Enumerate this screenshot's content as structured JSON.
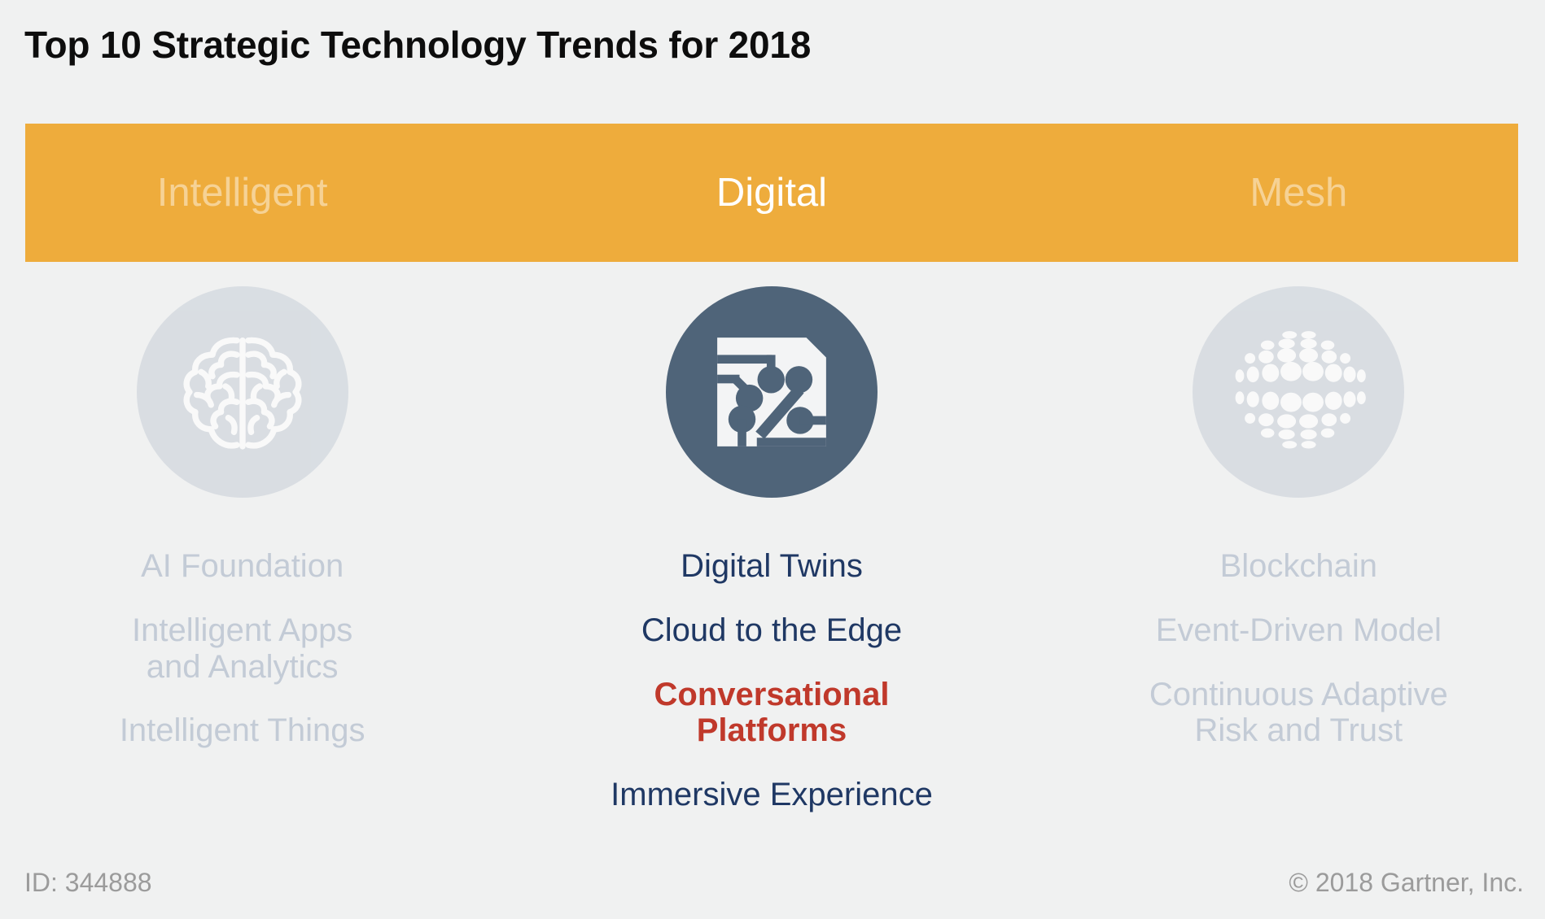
{
  "title": "Top 10 Strategic Technology Trends for 2018",
  "banner": {
    "categories": [
      {
        "label": "Intelligent",
        "state": "dim"
      },
      {
        "label": "Digital",
        "state": "active"
      },
      {
        "label": "Mesh",
        "state": "dim"
      }
    ],
    "background_color": "#eeac3c"
  },
  "columns": [
    {
      "category": "Intelligent",
      "icon": "brain-icon",
      "icon_state": "dim",
      "items": [
        {
          "label": "AI Foundation",
          "style": "dim"
        },
        {
          "label": "Intelligent Apps\nand Analytics",
          "style": "dim"
        },
        {
          "label": "Intelligent Things",
          "style": "dim"
        }
      ]
    },
    {
      "category": "Digital",
      "icon": "circuit-chip-icon",
      "icon_state": "active",
      "items": [
        {
          "label": "Digital Twins",
          "style": "active"
        },
        {
          "label": "Cloud to the Edge",
          "style": "active"
        },
        {
          "label": "Conversational\nPlatforms",
          "style": "highlight"
        },
        {
          "label": "Immersive Experience",
          "style": "active"
        }
      ]
    },
    {
      "category": "Mesh",
      "icon": "sphere-mesh-icon",
      "icon_state": "dim",
      "items": [
        {
          "label": "Blockchain",
          "style": "dim"
        },
        {
          "label": "Event-Driven Model",
          "style": "dim"
        },
        {
          "label": "Continuous Adaptive\nRisk and Trust",
          "style": "dim"
        }
      ]
    }
  ],
  "footer": {
    "id": "ID: 344888",
    "copyright": "© 2018 Gartner, Inc."
  },
  "colors": {
    "background": "#f0f1f1",
    "banner_orange": "#eeac3c",
    "active_icon_blue": "#4f6479",
    "dim_icon_grey": "#ccd2da",
    "active_text_navy": "#1f3864",
    "dim_text_grey": "#c3cbd6",
    "highlight_red": "#c0392b",
    "footer_grey": "#9b9b9b",
    "title_black": "#0d0d0d"
  }
}
